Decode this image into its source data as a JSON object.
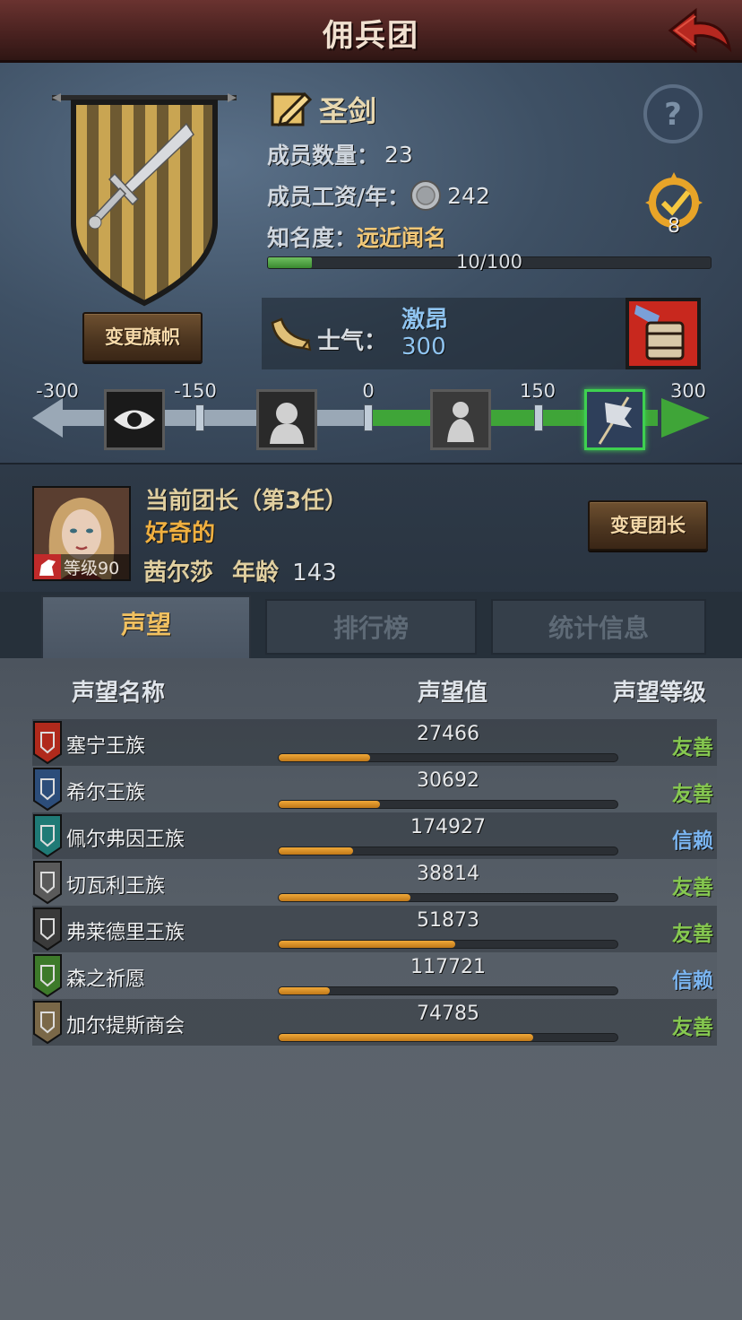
{
  "topbar": {
    "title": "佣兵团"
  },
  "guild": {
    "name": "圣剑",
    "members_label": "成员数量：",
    "members_value": "23",
    "wage_label": "成员工资/年：",
    "wage_value": "242",
    "fame_label": "知名度：",
    "fame_title": "远近闻名",
    "fame_progress_text": "10/100",
    "fame_fraction": 0.1,
    "rank_value": "8",
    "change_flag_label": "变更旗帜"
  },
  "morale": {
    "label": "士气：",
    "state": "激昂",
    "value": "300",
    "scale_labels": [
      "-300",
      "-150",
      "0",
      "150",
      "300"
    ],
    "active_level": "300"
  },
  "leader": {
    "title": "当前团长（第3任）",
    "trait": "好奇的",
    "name": "茜尔莎",
    "age_label": "年龄",
    "age_value": "143",
    "level_text": "等级90",
    "change_label": "变更团长"
  },
  "tabs": [
    {
      "label": "声望",
      "active": true
    },
    {
      "label": "排行榜",
      "active": false
    },
    {
      "label": "统计信息",
      "active": false
    }
  ],
  "reputation": {
    "headers": {
      "name": "声望名称",
      "value": "声望值",
      "level": "声望等级"
    },
    "rows": [
      {
        "name": "塞宁王族",
        "value": "27466",
        "level": "友善",
        "fill": 0.27,
        "level_color": "#86c850",
        "icon_color": "#b02a1c"
      },
      {
        "name": "希尔王族",
        "value": "30692",
        "level": "友善",
        "fill": 0.3,
        "level_color": "#86c850",
        "icon_color": "#2c4d7a"
      },
      {
        "name": "佩尔弗因王族",
        "value": "174927",
        "level": "信赖",
        "fill": 0.22,
        "level_color": "#7ab4f0",
        "icon_color": "#1f7a76"
      },
      {
        "name": "切瓦利王族",
        "value": "38814",
        "level": "友善",
        "fill": 0.39,
        "level_color": "#86c850",
        "icon_color": "#5a5a5a"
      },
      {
        "name": "弗莱德里王族",
        "value": "51873",
        "level": "友善",
        "fill": 0.52,
        "level_color": "#86c850",
        "icon_color": "#3a3a3a"
      },
      {
        "name": "森之祈愿",
        "value": "117721",
        "level": "信赖",
        "fill": 0.15,
        "level_color": "#7ab4f0",
        "icon_color": "#3d7a2a"
      },
      {
        "name": "加尔提斯商会",
        "value": "74785",
        "level": "友善",
        "fill": 0.75,
        "level_color": "#86c850",
        "icon_color": "#7a6848"
      }
    ]
  },
  "colors": {
    "accent_gold": "#f0c060",
    "banner_gold": "#c9a552",
    "banner_dark": "#6e5a32"
  }
}
